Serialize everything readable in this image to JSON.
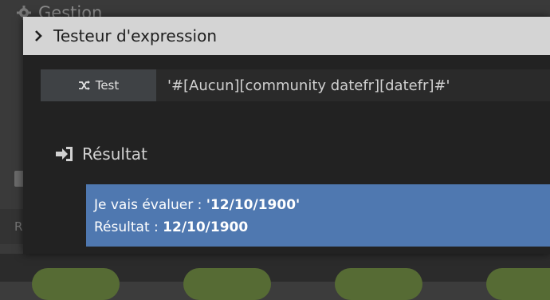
{
  "background": {
    "title": "Gestion",
    "left_label": "R"
  },
  "modal": {
    "title": "Testeur d'expression",
    "test_button_label": "Test",
    "expression_value": "'#[Aucun][community datefr][datefr]#'",
    "result_heading": "Résultat",
    "result_line1_prefix": "Je vais évaluer : ",
    "result_line1_value": "'12/10/1900'",
    "result_line2_prefix": "Résultat : ",
    "result_line2_value": "12/10/1900"
  },
  "icons": {
    "header": "chevron-right-icon",
    "test": "shuffle-icon",
    "result": "sign-in-icon",
    "bg_title": "gear-icon"
  },
  "colors": {
    "modal_header_bg": "#d4d4d4",
    "modal_body_bg": "#222222",
    "result_bg": "#4f78b0",
    "test_button_bg": "#3f4245",
    "bg_pill": "#566b34"
  }
}
